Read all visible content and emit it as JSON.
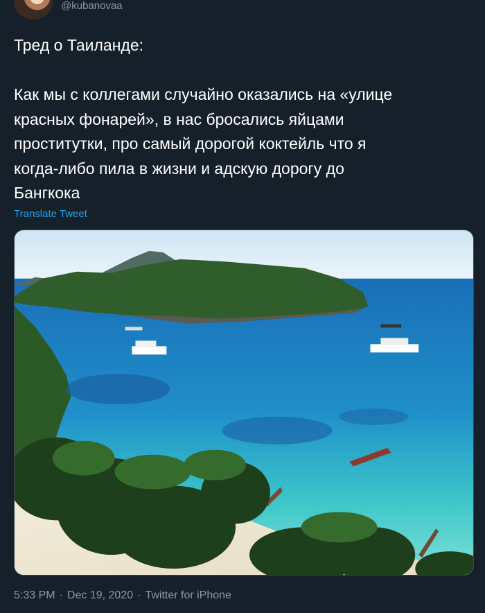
{
  "user": {
    "handle": "@kubanovaa"
  },
  "tweet": {
    "text": "Тред о Таиланде:\n\nКак мы с коллегами случайно оказались на «улице\nкрасных фонарей», в нас бросались яйцами\nпроститутки, про самый дорогой коктейль что я\nкогда-либо пила в жизни и адскую дорогу до\nБангкока",
    "translate_label": "Translate Tweet",
    "media_description": "tropical-bay-photo",
    "time": "5:33 PM",
    "date": "Dec 19, 2020",
    "source": "Twitter for iPhone",
    "separator": "·"
  },
  "colors": {
    "background": "#15202b",
    "text": "#ffffff",
    "secondary_text": "#8899a6",
    "link": "#1da1f2"
  }
}
